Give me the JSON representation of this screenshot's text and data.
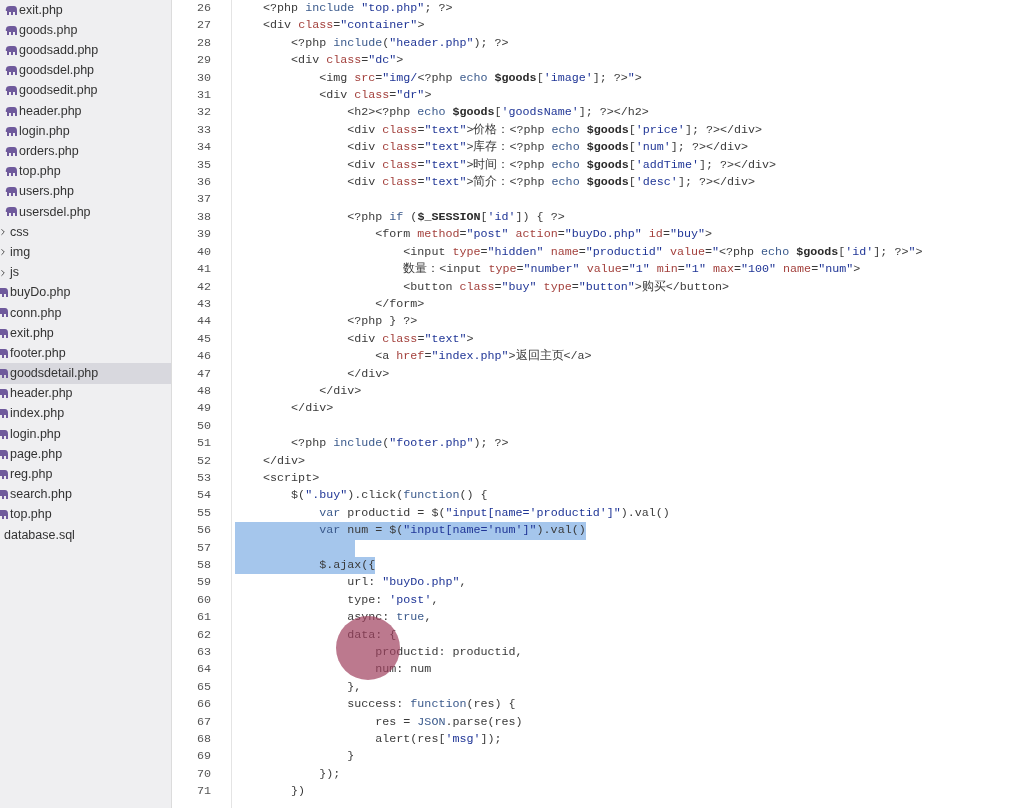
{
  "sidebar": {
    "nested_files": [
      {
        "name": "exit.php",
        "selected": false
      },
      {
        "name": "goods.php",
        "selected": false
      },
      {
        "name": "goodsadd.php",
        "selected": false
      },
      {
        "name": "goodsdel.php",
        "selected": false
      },
      {
        "name": "goodsedit.php",
        "selected": false
      },
      {
        "name": "header.php",
        "selected": false
      },
      {
        "name": "login.php",
        "selected": false
      },
      {
        "name": "orders.php",
        "selected": false
      },
      {
        "name": "top.php",
        "selected": false
      },
      {
        "name": "users.php",
        "selected": false
      },
      {
        "name": "usersdel.php",
        "selected": false
      }
    ],
    "items": [
      {
        "name": "css",
        "kind": "folder",
        "expanded": false,
        "selected": false
      },
      {
        "name": "img",
        "kind": "folder",
        "expanded": false,
        "selected": false
      },
      {
        "name": "js",
        "kind": "folder",
        "expanded": false,
        "selected": false
      },
      {
        "name": "buyDo.php",
        "kind": "php",
        "selected": false
      },
      {
        "name": "conn.php",
        "kind": "php",
        "selected": false
      },
      {
        "name": "exit.php",
        "kind": "php",
        "selected": false
      },
      {
        "name": "footer.php",
        "kind": "php",
        "selected": false
      },
      {
        "name": "goodsdetail.php",
        "kind": "php",
        "selected": true
      },
      {
        "name": "header.php",
        "kind": "php",
        "selected": false
      },
      {
        "name": "index.php",
        "kind": "php",
        "selected": false
      },
      {
        "name": "login.php",
        "kind": "php",
        "selected": false
      },
      {
        "name": "page.php",
        "kind": "php",
        "selected": false
      },
      {
        "name": "reg.php",
        "kind": "php",
        "selected": false
      },
      {
        "name": "search.php",
        "kind": "php",
        "selected": false
      },
      {
        "name": "top.php",
        "kind": "php",
        "selected": false
      },
      {
        "name": "database.sql",
        "kind": "file",
        "selected": false
      }
    ]
  },
  "editor": {
    "lines": [
      {
        "number": "26",
        "selected": false,
        "tokens": [
          {
            "text": "    <?php ",
            "kind": "plain"
          },
          {
            "text": "include ",
            "kind": "kw"
          },
          {
            "text": "\"top.php\"",
            "kind": "str"
          },
          {
            "text": "; ?>",
            "kind": "plain"
          }
        ]
      },
      {
        "number": "27",
        "selected": false,
        "tokens": [
          {
            "text": "    <div ",
            "kind": "plain"
          },
          {
            "text": "class",
            "kind": "attr"
          },
          {
            "text": "=",
            "kind": "plain"
          },
          {
            "text": "\"container\"",
            "kind": "str"
          },
          {
            "text": ">",
            "kind": "plain"
          }
        ]
      },
      {
        "number": "28",
        "selected": false,
        "tokens": [
          {
            "text": "        <?php ",
            "kind": "plain"
          },
          {
            "text": "include",
            "kind": "kw"
          },
          {
            "text": "(",
            "kind": "plain"
          },
          {
            "text": "\"header.php\"",
            "kind": "str"
          },
          {
            "text": "); ?>",
            "kind": "plain"
          }
        ]
      },
      {
        "number": "29",
        "selected": false,
        "tokens": [
          {
            "text": "        <div ",
            "kind": "plain"
          },
          {
            "text": "class",
            "kind": "attr"
          },
          {
            "text": "=",
            "kind": "plain"
          },
          {
            "text": "\"dc\"",
            "kind": "str"
          },
          {
            "text": ">",
            "kind": "plain"
          }
        ]
      },
      {
        "number": "30",
        "selected": false,
        "tokens": [
          {
            "text": "            <img ",
            "kind": "plain"
          },
          {
            "text": "src",
            "kind": "attr"
          },
          {
            "text": "=",
            "kind": "plain"
          },
          {
            "text": "\"img/",
            "kind": "str"
          },
          {
            "text": "<?php ",
            "kind": "plain"
          },
          {
            "text": "echo ",
            "kind": "kw"
          },
          {
            "text": "$goods",
            "kind": "var"
          },
          {
            "text": "[",
            "kind": "plain"
          },
          {
            "text": "'image'",
            "kind": "str"
          },
          {
            "text": "]; ?>",
            "kind": "plain"
          },
          {
            "text": "\"",
            "kind": "str"
          },
          {
            "text": ">",
            "kind": "plain"
          }
        ]
      },
      {
        "number": "31",
        "selected": false,
        "tokens": [
          {
            "text": "            <div ",
            "kind": "plain"
          },
          {
            "text": "class",
            "kind": "attr"
          },
          {
            "text": "=",
            "kind": "plain"
          },
          {
            "text": "\"dr\"",
            "kind": "str"
          },
          {
            "text": ">",
            "kind": "plain"
          }
        ]
      },
      {
        "number": "32",
        "selected": false,
        "tokens": [
          {
            "text": "                <h2><?php ",
            "kind": "plain"
          },
          {
            "text": "echo ",
            "kind": "kw"
          },
          {
            "text": "$goods",
            "kind": "var"
          },
          {
            "text": "[",
            "kind": "plain"
          },
          {
            "text": "'goodsName'",
            "kind": "str"
          },
          {
            "text": "]; ?></h2>",
            "kind": "plain"
          }
        ]
      },
      {
        "number": "33",
        "selected": false,
        "tokens": [
          {
            "text": "                <div ",
            "kind": "plain"
          },
          {
            "text": "class",
            "kind": "attr"
          },
          {
            "text": "=",
            "kind": "plain"
          },
          {
            "text": "\"text\"",
            "kind": "str"
          },
          {
            "text": ">价格：<?php ",
            "kind": "plain"
          },
          {
            "text": "echo ",
            "kind": "kw"
          },
          {
            "text": "$goods",
            "kind": "var"
          },
          {
            "text": "[",
            "kind": "plain"
          },
          {
            "text": "'price'",
            "kind": "str"
          },
          {
            "text": "]; ?></div>",
            "kind": "plain"
          }
        ]
      },
      {
        "number": "34",
        "selected": false,
        "tokens": [
          {
            "text": "                <div ",
            "kind": "plain"
          },
          {
            "text": "class",
            "kind": "attr"
          },
          {
            "text": "=",
            "kind": "plain"
          },
          {
            "text": "\"text\"",
            "kind": "str"
          },
          {
            "text": ">库存：<?php ",
            "kind": "plain"
          },
          {
            "text": "echo ",
            "kind": "kw"
          },
          {
            "text": "$goods",
            "kind": "var"
          },
          {
            "text": "[",
            "kind": "plain"
          },
          {
            "text": "'num'",
            "kind": "str"
          },
          {
            "text": "]; ?></div>",
            "kind": "plain"
          }
        ]
      },
      {
        "number": "35",
        "selected": false,
        "tokens": [
          {
            "text": "                <div ",
            "kind": "plain"
          },
          {
            "text": "class",
            "kind": "attr"
          },
          {
            "text": "=",
            "kind": "plain"
          },
          {
            "text": "\"text\"",
            "kind": "str"
          },
          {
            "text": ">时间：<?php ",
            "kind": "plain"
          },
          {
            "text": "echo ",
            "kind": "kw"
          },
          {
            "text": "$goods",
            "kind": "var"
          },
          {
            "text": "[",
            "kind": "plain"
          },
          {
            "text": "'addTime'",
            "kind": "str"
          },
          {
            "text": "]; ?></div>",
            "kind": "plain"
          }
        ]
      },
      {
        "number": "36",
        "selected": false,
        "tokens": [
          {
            "text": "                <div ",
            "kind": "plain"
          },
          {
            "text": "class",
            "kind": "attr"
          },
          {
            "text": "=",
            "kind": "plain"
          },
          {
            "text": "\"text\"",
            "kind": "str"
          },
          {
            "text": ">简介：<?php ",
            "kind": "plain"
          },
          {
            "text": "echo ",
            "kind": "kw"
          },
          {
            "text": "$goods",
            "kind": "var"
          },
          {
            "text": "[",
            "kind": "plain"
          },
          {
            "text": "'desc'",
            "kind": "str"
          },
          {
            "text": "]; ?></div>",
            "kind": "plain"
          }
        ]
      },
      {
        "number": "37",
        "selected": false
      },
      {
        "number": "38",
        "selected": false,
        "tokens": [
          {
            "text": "                <?php ",
            "kind": "plain"
          },
          {
            "text": "if ",
            "kind": "kw"
          },
          {
            "text": "(",
            "kind": "plain"
          },
          {
            "text": "$_SESSION",
            "kind": "var"
          },
          {
            "text": "[",
            "kind": "plain"
          },
          {
            "text": "'id'",
            "kind": "str"
          },
          {
            "text": "]) { ?>",
            "kind": "plain"
          }
        ]
      },
      {
        "number": "39",
        "selected": false,
        "tokens": [
          {
            "text": "                    <form ",
            "kind": "plain"
          },
          {
            "text": "method",
            "kind": "attr"
          },
          {
            "text": "=",
            "kind": "plain"
          },
          {
            "text": "\"post\"",
            "kind": "str"
          },
          {
            "text": " action",
            "kind": "attr"
          },
          {
            "text": "=",
            "kind": "plain"
          },
          {
            "text": "\"buyDo.php\"",
            "kind": "str"
          },
          {
            "text": " id",
            "kind": "attr"
          },
          {
            "text": "=",
            "kind": "plain"
          },
          {
            "text": "\"buy\"",
            "kind": "str"
          },
          {
            "text": ">",
            "kind": "plain"
          }
        ]
      },
      {
        "number": "40",
        "selected": false,
        "tokens": [
          {
            "text": "                        <input ",
            "kind": "plain"
          },
          {
            "text": "type",
            "kind": "attr"
          },
          {
            "text": "=",
            "kind": "plain"
          },
          {
            "text": "\"hidden\"",
            "kind": "str"
          },
          {
            "text": " name",
            "kind": "attr"
          },
          {
            "text": "=",
            "kind": "plain"
          },
          {
            "text": "\"productid\"",
            "kind": "str"
          },
          {
            "text": " value",
            "kind": "attr"
          },
          {
            "text": "=",
            "kind": "plain"
          },
          {
            "text": "\"",
            "kind": "str"
          },
          {
            "text": "<?php ",
            "kind": "plain"
          },
          {
            "text": "echo ",
            "kind": "kw"
          },
          {
            "text": "$goods",
            "kind": "var"
          },
          {
            "text": "[",
            "kind": "plain"
          },
          {
            "text": "'id'",
            "kind": "str"
          },
          {
            "text": "]; ?>",
            "kind": "plain"
          },
          {
            "text": "\"",
            "kind": "str"
          },
          {
            "text": ">",
            "kind": "plain"
          }
        ]
      },
      {
        "number": "41",
        "selected": false,
        "tokens": [
          {
            "text": "                        数量：<input ",
            "kind": "plain"
          },
          {
            "text": "type",
            "kind": "attr"
          },
          {
            "text": "=",
            "kind": "plain"
          },
          {
            "text": "\"number\"",
            "kind": "str"
          },
          {
            "text": " value",
            "kind": "attr"
          },
          {
            "text": "=",
            "kind": "plain"
          },
          {
            "text": "\"1\"",
            "kind": "str"
          },
          {
            "text": " min",
            "kind": "attr"
          },
          {
            "text": "=",
            "kind": "plain"
          },
          {
            "text": "\"1\"",
            "kind": "str"
          },
          {
            "text": " max",
            "kind": "attr"
          },
          {
            "text": "=",
            "kind": "plain"
          },
          {
            "text": "\"100\"",
            "kind": "str"
          },
          {
            "text": " name",
            "kind": "attr"
          },
          {
            "text": "=",
            "kind": "plain"
          },
          {
            "text": "\"num\"",
            "kind": "str"
          },
          {
            "text": ">",
            "kind": "plain"
          }
        ]
      },
      {
        "number": "42",
        "selected": false,
        "tokens": [
          {
            "text": "                        <button ",
            "kind": "plain"
          },
          {
            "text": "class",
            "kind": "attr"
          },
          {
            "text": "=",
            "kind": "plain"
          },
          {
            "text": "\"buy\"",
            "kind": "str"
          },
          {
            "text": " type",
            "kind": "attr"
          },
          {
            "text": "=",
            "kind": "plain"
          },
          {
            "text": "\"button\"",
            "kind": "str"
          },
          {
            "text": ">购买</button>",
            "kind": "plain"
          }
        ]
      },
      {
        "number": "43",
        "selected": false,
        "tokens": [
          {
            "text": "                    </form>",
            "kind": "plain"
          }
        ]
      },
      {
        "number": "44",
        "selected": false,
        "tokens": [
          {
            "text": "                <?php } ?>",
            "kind": "plain"
          }
        ]
      },
      {
        "number": "45",
        "selected": false,
        "tokens": [
          {
            "text": "                <div ",
            "kind": "plain"
          },
          {
            "text": "class",
            "kind": "attr"
          },
          {
            "text": "=",
            "kind": "plain"
          },
          {
            "text": "\"text\"",
            "kind": "str"
          },
          {
            "text": ">",
            "kind": "plain"
          }
        ]
      },
      {
        "number": "46",
        "selected": false,
        "tokens": [
          {
            "text": "                    <a ",
            "kind": "plain"
          },
          {
            "text": "href",
            "kind": "attr"
          },
          {
            "text": "=",
            "kind": "plain"
          },
          {
            "text": "\"index.php\"",
            "kind": "str"
          },
          {
            "text": ">返回主页</a>",
            "kind": "plain"
          }
        ]
      },
      {
        "number": "47",
        "selected": false,
        "tokens": [
          {
            "text": "                </div>",
            "kind": "plain"
          }
        ]
      },
      {
        "number": "48",
        "selected": false,
        "tokens": [
          {
            "text": "            </div>",
            "kind": "plain"
          }
        ]
      },
      {
        "number": "49",
        "selected": false,
        "tokens": [
          {
            "text": "        </div>",
            "kind": "plain"
          }
        ]
      },
      {
        "number": "50",
        "selected": false
      },
      {
        "number": "51",
        "selected": false,
        "tokens": [
          {
            "text": "        <?php ",
            "kind": "plain"
          },
          {
            "text": "include",
            "kind": "kw"
          },
          {
            "text": "(",
            "kind": "plain"
          },
          {
            "text": "\"footer.php\"",
            "kind": "str"
          },
          {
            "text": "); ?>",
            "kind": "plain"
          }
        ]
      },
      {
        "number": "52",
        "selected": false,
        "tokens": [
          {
            "text": "    </div>",
            "kind": "plain"
          }
        ]
      },
      {
        "number": "53",
        "selected": false,
        "tokens": [
          {
            "text": "    <script>",
            "kind": "plain"
          }
        ]
      },
      {
        "number": "54",
        "selected": false,
        "tokens": [
          {
            "text": "        $(",
            "kind": "plain"
          },
          {
            "text": "\".buy\"",
            "kind": "str"
          },
          {
            "text": ").click(",
            "kind": "plain"
          },
          {
            "text": "function",
            "kind": "kw"
          },
          {
            "text": "() {",
            "kind": "plain"
          }
        ]
      },
      {
        "number": "55",
        "selected": false,
        "tokens": [
          {
            "text": "            var ",
            "kind": "kw"
          },
          {
            "text": "productid = $(",
            "kind": "plain"
          },
          {
            "text": "\"input[name='productid']\"",
            "kind": "str"
          },
          {
            "text": ").val()",
            "kind": "plain"
          }
        ]
      },
      {
        "number": "56",
        "selected": true,
        "tokens": [
          {
            "text": "            var ",
            "kind": "kw"
          },
          {
            "text": "num = $(",
            "kind": "plain"
          },
          {
            "text": "\"input[name='num']\"",
            "kind": "str"
          },
          {
            "text": ").val()",
            "kind": "plain"
          }
        ]
      },
      {
        "number": "57",
        "selected": true
      },
      {
        "number": "58",
        "selected": true,
        "tokens": [
          {
            "text": "            $.ajax({",
            "kind": "plain"
          }
        ]
      },
      {
        "number": "59",
        "selected": false,
        "tokens": [
          {
            "text": "                url: ",
            "kind": "plain"
          },
          {
            "text": "\"buyDo.php\"",
            "kind": "str"
          },
          {
            "text": ",",
            "kind": "plain"
          }
        ]
      },
      {
        "number": "60",
        "selected": false,
        "tokens": [
          {
            "text": "                type: ",
            "kind": "plain"
          },
          {
            "text": "'post'",
            "kind": "str"
          },
          {
            "text": ",",
            "kind": "plain"
          }
        ]
      },
      {
        "number": "61",
        "selected": false,
        "tokens": [
          {
            "text": "                async: ",
            "kind": "plain"
          },
          {
            "text": "true",
            "kind": "kw"
          },
          {
            "text": ",",
            "kind": "plain"
          }
        ]
      },
      {
        "number": "62",
        "selected": false,
        "tokens": [
          {
            "text": "                data: {",
            "kind": "plain"
          }
        ]
      },
      {
        "number": "63",
        "selected": false,
        "tokens": [
          {
            "text": "                    productid: productid,",
            "kind": "plain"
          }
        ]
      },
      {
        "number": "64",
        "selected": false,
        "tokens": [
          {
            "text": "                    num: num",
            "kind": "plain"
          }
        ]
      },
      {
        "number": "65",
        "selected": false,
        "tokens": [
          {
            "text": "                },",
            "kind": "plain"
          }
        ]
      },
      {
        "number": "66",
        "selected": false,
        "tokens": [
          {
            "text": "                success: ",
            "kind": "plain"
          },
          {
            "text": "function",
            "kind": "kw"
          },
          {
            "text": "(res) {",
            "kind": "plain"
          }
        ]
      },
      {
        "number": "67",
        "selected": false,
        "tokens": [
          {
            "text": "                    res = ",
            "kind": "plain"
          },
          {
            "text": "JSON",
            "kind": "kw"
          },
          {
            "text": ".parse(res)",
            "kind": "plain"
          }
        ]
      },
      {
        "number": "68",
        "selected": false,
        "tokens": [
          {
            "text": "                    alert(res[",
            "kind": "plain"
          },
          {
            "text": "'msg'",
            "kind": "str"
          },
          {
            "text": "]);",
            "kind": "plain"
          }
        ]
      },
      {
        "number": "69",
        "selected": false,
        "tokens": [
          {
            "text": "                }",
            "kind": "plain"
          }
        ]
      },
      {
        "number": "70",
        "selected": false,
        "tokens": [
          {
            "text": "            });",
            "kind": "plain"
          }
        ]
      },
      {
        "number": "71",
        "selected": false,
        "tokens": [
          {
            "text": "        })",
            "kind": "plain"
          }
        ]
      }
    ]
  }
}
